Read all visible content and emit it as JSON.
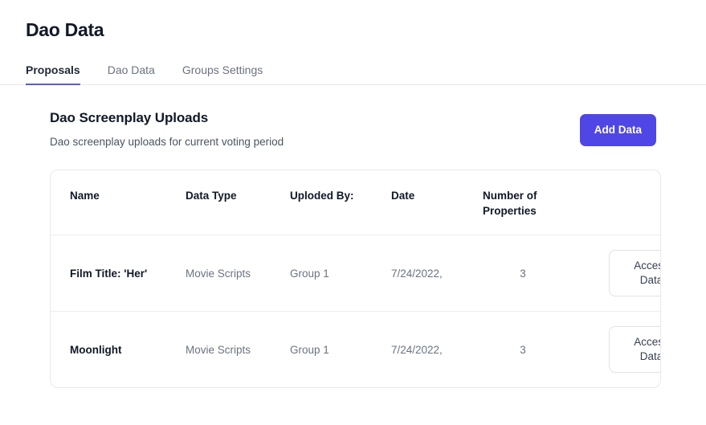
{
  "header": {
    "title": "Dao Data"
  },
  "tabs": [
    {
      "label": "Proposals",
      "active": true
    },
    {
      "label": "Dao Data",
      "active": false
    },
    {
      "label": "Groups Settings",
      "active": false
    }
  ],
  "section": {
    "title": "Dao Screenplay Uploads",
    "subtitle": "Dao screenplay uploads for current voting period",
    "add_button_label": "Add Data"
  },
  "table": {
    "columns": [
      "Name",
      "Data Type",
      "Uploded By:",
      "Date",
      "Number of Properties",
      ""
    ],
    "rows": [
      {
        "name": "Film Title: 'Her'",
        "data_type": "Movie Scripts",
        "uploaded_by": "Group 1",
        "date": "7/24/2022,",
        "number_of_properties": "3",
        "action_label": "Access Data"
      },
      {
        "name": "Moonlight",
        "data_type": "Movie Scripts",
        "uploaded_by": "Group 1",
        "date": "7/24/2022,",
        "number_of_properties": "3",
        "action_label": "Access Data"
      }
    ]
  },
  "colors": {
    "accent": "#4f46e5",
    "tab_active_underline": "#5b5bd6",
    "text_primary": "#111827",
    "text_muted": "#6b7280",
    "border": "#e9e9ec"
  }
}
